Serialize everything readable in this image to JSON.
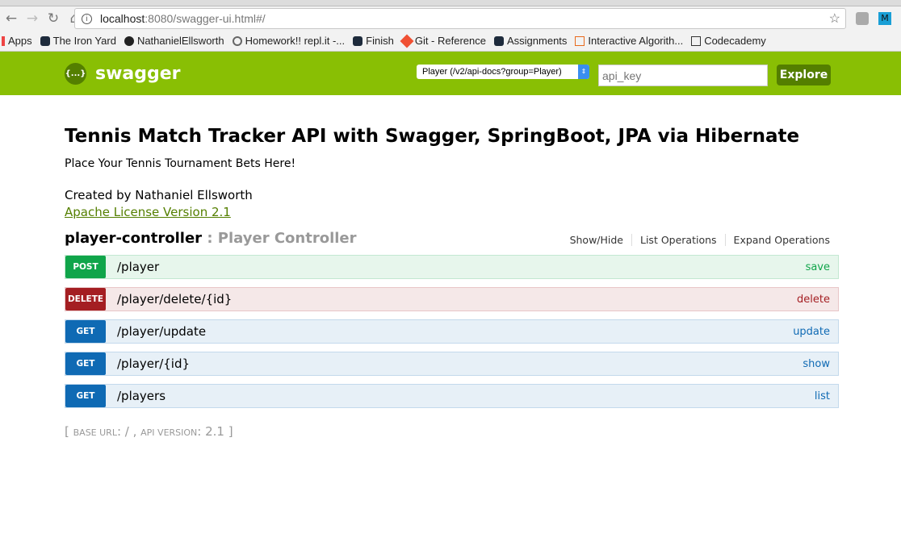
{
  "browser": {
    "url_host": "localhost",
    "url_rest": ":8080/swagger-ui.html#/",
    "ext_label": "M",
    "bookmarks": [
      "Apps",
      "The Iron Yard",
      "NathanielEllsworth",
      "Homework!! repl.it -...",
      "Finish",
      "Git - Reference",
      "Assignments",
      "Interactive Algorith...",
      "Codecademy"
    ]
  },
  "header": {
    "logo": "swagger",
    "logo_icon": "{...}",
    "spec_select": "Player (/v2/api-docs?group=Player)",
    "api_key_placeholder": "api_key",
    "explore": "Explore"
  },
  "info": {
    "title": "Tennis Match Tracker API with Swagger, SpringBoot, JPA via Hibernate",
    "description": "Place Your Tennis Tournament Bets Here!",
    "author": "Created by Nathaniel Ellsworth",
    "license": "Apache License Version 2.1"
  },
  "controller": {
    "name": "player-controller",
    "separator": " : ",
    "desc": "Player Controller",
    "actions": [
      "Show/Hide",
      "List Operations",
      "Expand Operations"
    ]
  },
  "operations": [
    {
      "method": "POST",
      "path": "/player",
      "summary": "save"
    },
    {
      "method": "DELETE",
      "path": "/player/delete/{id}",
      "summary": "delete"
    },
    {
      "method": "GET",
      "path": "/player/update",
      "summary": "update"
    },
    {
      "method": "GET",
      "path": "/player/{id}",
      "summary": "show"
    },
    {
      "method": "GET",
      "path": "/players",
      "summary": "list"
    }
  ],
  "footer": {
    "open": "[ ",
    "base_url_label": "BASE URL",
    "base_url": ": / , ",
    "api_version_label": "API VERSION",
    "api_version": ": 2.1",
    "close": " ]"
  },
  "colors": {
    "post": "#10a54a",
    "delete": "#a41e22",
    "get": "#0f6ab4",
    "header": "#89bf04"
  }
}
